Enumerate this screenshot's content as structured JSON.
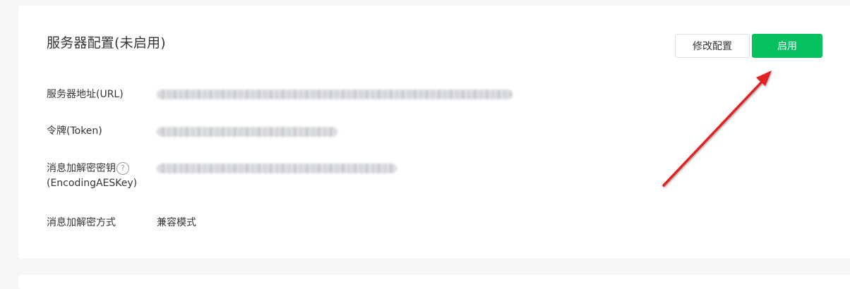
{
  "section": {
    "title": "服务器配置(未启用)",
    "buttons": {
      "modify_label": "修改配置",
      "enable_label": "启用"
    },
    "rows": [
      {
        "label": "服务器地址(URL)",
        "value": ""
      },
      {
        "label": "令牌(Token)",
        "value": ""
      },
      {
        "label_line1": "消息加解密密钥",
        "label_line2": "(EncodingAESKey)",
        "value": ""
      },
      {
        "label": "消息加解密方式",
        "value": "兼容模式"
      }
    ],
    "help_icon_glyph": "?"
  },
  "annotation": {
    "arrow_color": "#e02020"
  },
  "colors": {
    "accent": "#07c160",
    "background": "#f5f6f7",
    "card": "#ffffff"
  }
}
